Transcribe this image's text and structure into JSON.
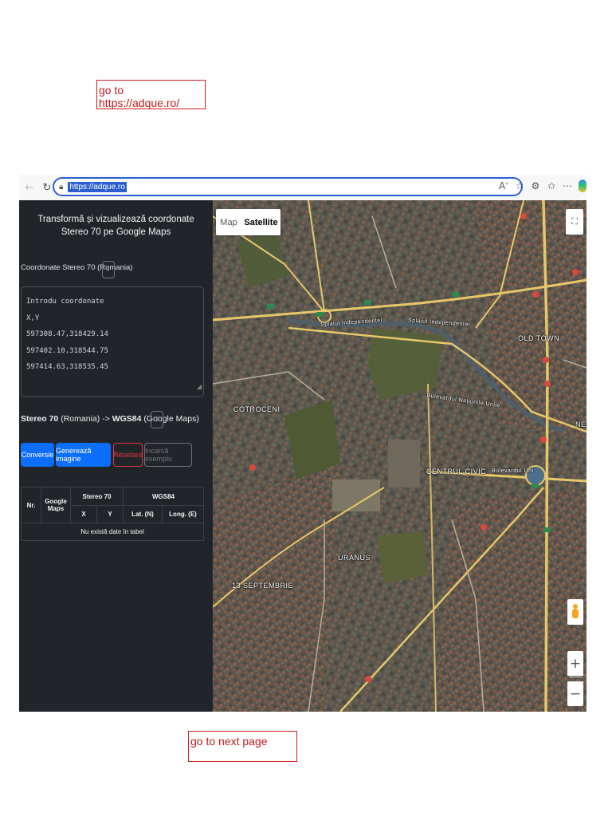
{
  "annotations": {
    "top": "go to https://adque.ro/",
    "bottom": "go to next page"
  },
  "browser": {
    "url": "https://adque.ro",
    "icons": {
      "back": "back-arrow-icon",
      "refresh": "refresh-icon",
      "lock": "lock-icon",
      "read_aloud_label": "A",
      "favorite": "star-icon",
      "extensions": "extensions-icon",
      "favorites": "favorites-icon",
      "more": "more-icon",
      "copilot": "copilot-icon"
    }
  },
  "sidebar": {
    "title_line1": "Transformă și vizualizează coordonate",
    "title_line2": "Stereo 70 pe Google Maps",
    "coord_label": "Coordonate Stereo 70 (Romania)",
    "info_symbol": "i",
    "textarea_value": "Introdu coordonate\nX,Y\n597308.47,318429.14\n597402.10,318544.75\n597414.63,318535.45",
    "conversion_heading": {
      "from_bold": "Stereo 70",
      "from_rest": " (Romania) -> ",
      "to_bold": "WGS84",
      "to_rest": " (Google Maps)"
    },
    "buttons": {
      "conversie": "Conversie",
      "genereaza": "Generează imagine",
      "resetare": "Resetare",
      "incarca": "Incarcă exemplu"
    },
    "table": {
      "col_nr": "Nr.",
      "col_google_maps": "Google Maps",
      "group_stereo": "Stereo 70",
      "group_wgs": "WGS84",
      "col_x": "X",
      "col_y": "Y",
      "col_lat": "Lat. (N)",
      "col_long": "Long. (E)",
      "empty_message": "Nu există date în tabel"
    }
  },
  "map": {
    "type_map": "Map",
    "type_satellite": "Satellite",
    "labels": {
      "old_town": "OLD TOWN",
      "cotroceni": "COTROCENI",
      "centrul_civic": "CENTRUL CIVIC",
      "uranus": "URANUS",
      "septembrie": "13 SEPTEMBRIE",
      "nec": "NEC"
    },
    "street_labels": {
      "splaiul_1": "Splaiul Independentei",
      "splaiul_2": "Splaiul Independentei",
      "unirii": "Bulevardul Națiunile Unite",
      "bd_unirii": "Bulevardul Uni"
    },
    "controls": {
      "fullscreen": "fullscreen-icon",
      "pegman": "pegman-icon",
      "zoom_in": "+",
      "zoom_out": "−"
    },
    "colors": {
      "road_major": "#e6c86a",
      "road_minor": "#b8b09a",
      "urban": "#5d5a52",
      "park": "#4f5a36"
    }
  }
}
